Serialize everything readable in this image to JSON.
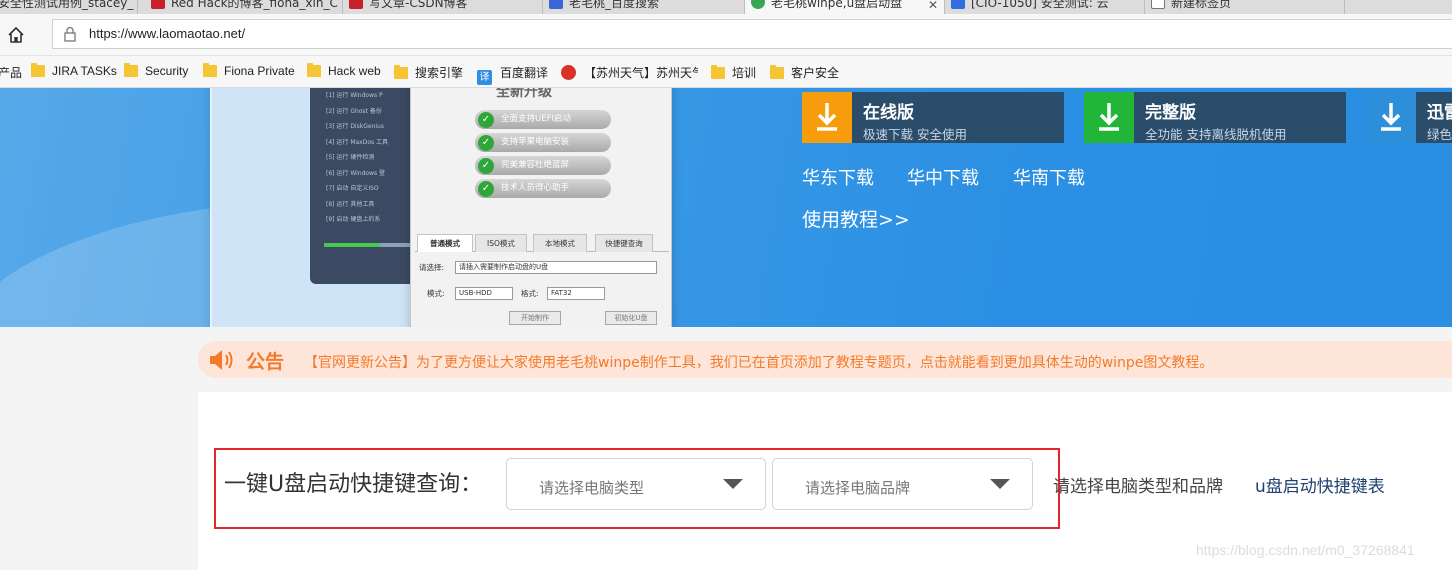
{
  "browser": {
    "tabs": [
      {
        "title": "安全性测试用例_stacey_"
      },
      {
        "title": "Red Hack的博客_fiona_xin_C"
      },
      {
        "title": "写文章-CSDN博客"
      },
      {
        "title": "老毛桃_百度搜索"
      },
      {
        "title": "老毛桃winpe,u盘启动盘",
        "active": true
      },
      {
        "title": "[CIO-1050] 安全测试: 云"
      },
      {
        "title": "新建标签页"
      }
    ],
    "url": "https://www.laomaotao.net/",
    "bookmarks": [
      {
        "label": "产品",
        "icon": "folder-icon"
      },
      {
        "label": "JIRA TASKs",
        "icon": "folder-icon"
      },
      {
        "label": "Security",
        "icon": "folder-icon"
      },
      {
        "label": "Fiona Private",
        "icon": "folder-icon"
      },
      {
        "label": "Hack web",
        "icon": "folder-icon"
      },
      {
        "label": "搜索引擎",
        "icon": "folder-icon"
      },
      {
        "label": "百度翻译",
        "icon": "translate-icon"
      },
      {
        "label": "【苏州天气】苏州天气",
        "icon": "weather-icon"
      },
      {
        "label": "培训",
        "icon": "folder-icon"
      },
      {
        "label": "客户安全",
        "icon": "folder-icon"
      }
    ]
  },
  "banner": {
    "product_window": {
      "title": "全新升级",
      "features": [
        "全面支持UEFI启动",
        "支持苹果电脑安装",
        "完美兼容杜绝蓝屏",
        "技术人员得心助手"
      ],
      "tabs": [
        "普通模式",
        "ISO模式",
        "本地模式",
        "快捷键查询"
      ],
      "select_label": "请选择:",
      "select_value": "请插入需要制作启动盘的U盘",
      "mode_label": "模式:",
      "mode_value": "USB-HDD",
      "format_label": "格式:",
      "format_value": "FAT32",
      "buttons": [
        "开始制作",
        "初始化U盘"
      ],
      "menu_lines": [
        "运行 Windows P",
        "运行 Ghost 备份",
        "运行 DiskGenius",
        "运行 MaxDos 工具",
        "运行 硬件检测",
        "运行 Windows 登",
        "启动 自定义ISO",
        "运行 其他工具",
        "启动 硬盘上的系"
      ]
    },
    "downloads": [
      {
        "title": "在线版",
        "subtitle": "极速下载 安全使用",
        "color": "#f79d0c"
      },
      {
        "title": "完整版",
        "subtitle": "全功能 支持离线脱机使用",
        "color": "#21b638"
      },
      {
        "title": "迅雷",
        "subtitle": "绿色",
        "color": "#2d8fd9"
      }
    ],
    "regions": [
      "华东下载",
      "华中下载",
      "华南下载"
    ],
    "tutorial": "使用教程>>"
  },
  "notice": {
    "title": "公告",
    "text": "【官网更新公告】为了更方便让大家使用老毛桃winpe制作工具，我们已在首页添加了教程专题页，点击就能看到更加具体生动的winpe图文教程。"
  },
  "query": {
    "label": "一键U盘启动快捷键查询：",
    "type_placeholder": "请选择电脑类型",
    "brand_placeholder": "请选择电脑品牌",
    "hint": "请选择电脑类型和品牌",
    "link": "u盘启动快捷键表"
  },
  "watermark": "https://blog.csdn.net/m0_37268841",
  "colors": {
    "notice_orange": "#f47a2a",
    "highlight_red": "#e4262b",
    "banner_blue": "#3c9be6"
  }
}
